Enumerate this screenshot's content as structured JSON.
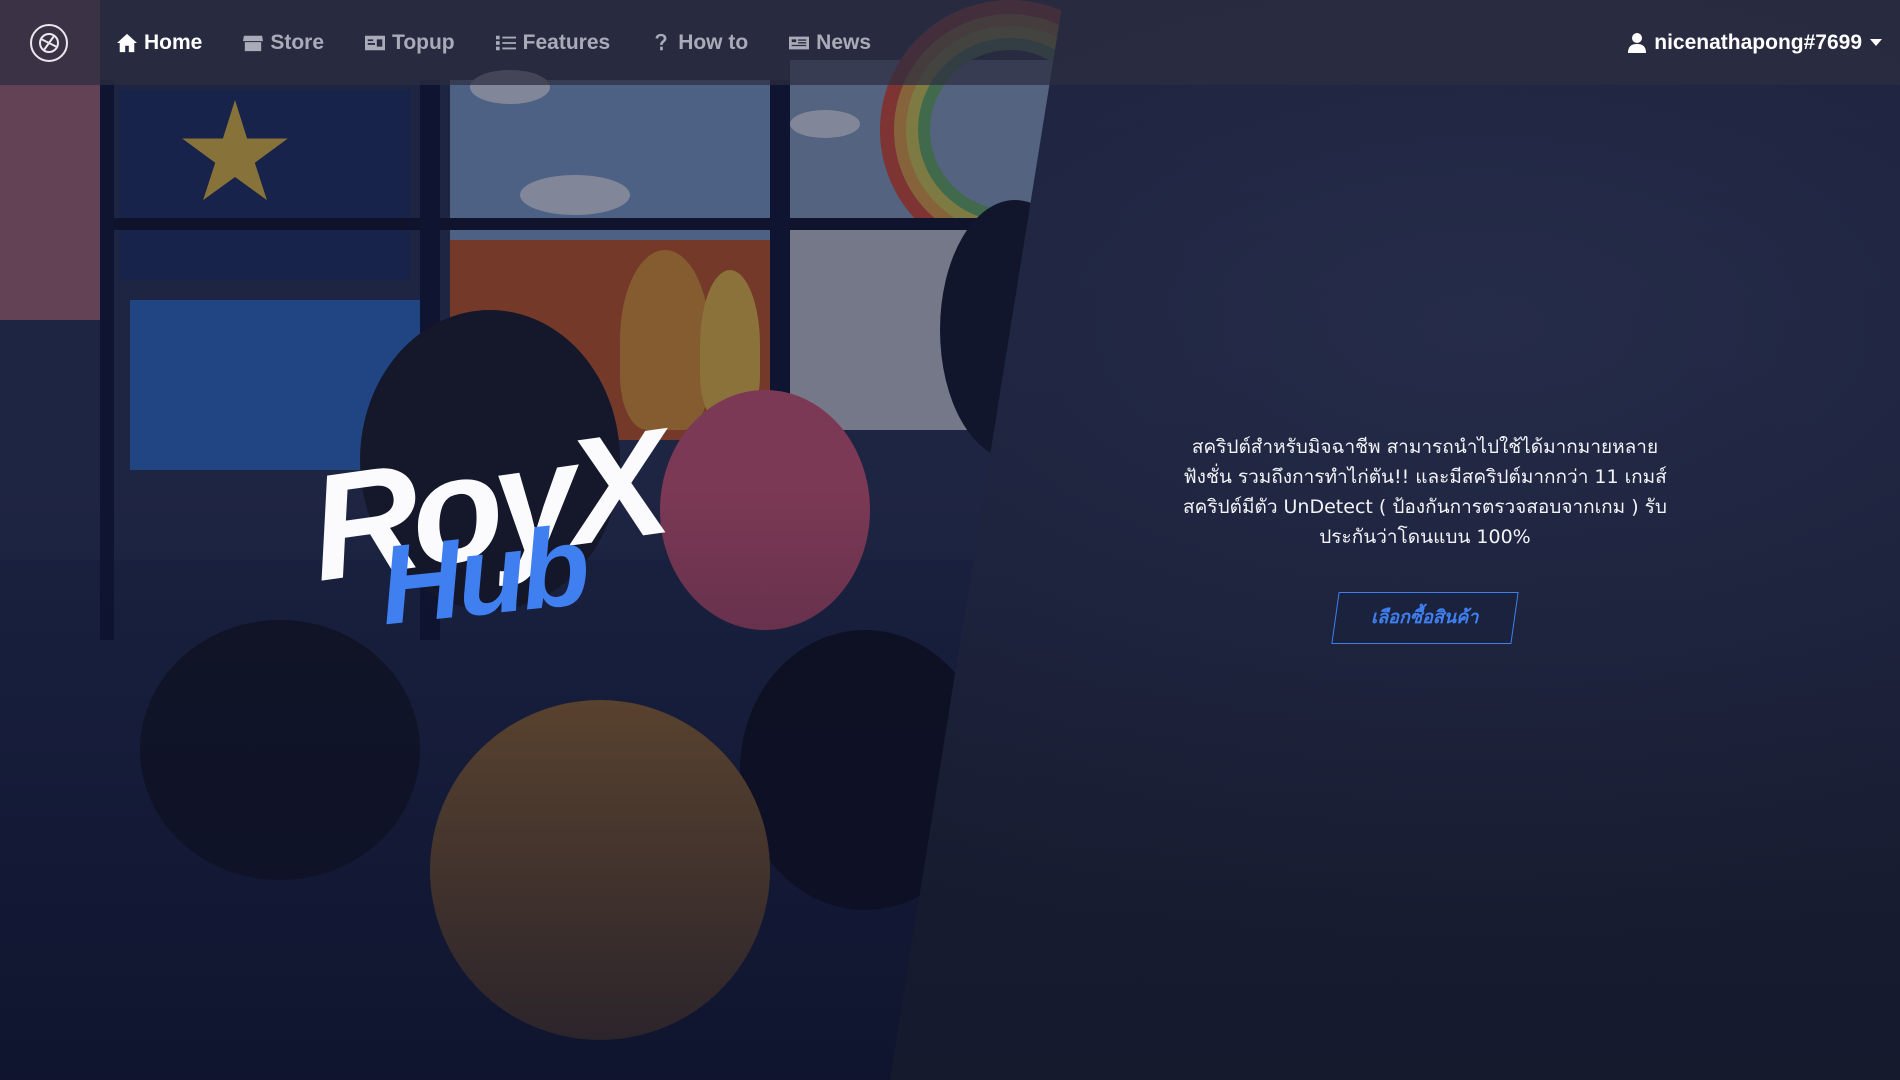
{
  "nav": {
    "items": [
      {
        "label": "Home",
        "icon": "home-icon",
        "active": true
      },
      {
        "label": "Store",
        "icon": "store-icon",
        "active": false
      },
      {
        "label": "Topup",
        "icon": "topup-icon",
        "active": false
      },
      {
        "label": "Features",
        "icon": "list-icon",
        "active": false
      },
      {
        "label": "How to",
        "icon": "question-icon",
        "active": false
      },
      {
        "label": "News",
        "icon": "news-icon",
        "active": false
      }
    ],
    "user": {
      "name": "nicenathapong#7699",
      "icon": "user-icon",
      "dropdown_icon": "caret-down-icon"
    }
  },
  "brand": {
    "name": "RoyX",
    "sub": "Hub",
    "colors": {
      "main": "#fbfbfd",
      "sub": "#3f7ff0"
    }
  },
  "hero": {
    "description": "สคริปต์สำหรับมิจฉาชีพ สามารถนำไปใช้ได้มากมายหลายฟังชั่น รวมถึงการทำไก่ตัน!! และมีสคริปต์มากกว่า 11 เกมส์ สคริปต์มีตัว UnDetect ( ป้องกันการตรวจสอบจากเกม ) รับประกันว่าโดนแบน 100%",
    "cta_label": "เลือกซื้อสินค้า",
    "accent": "#3f7ff0"
  }
}
